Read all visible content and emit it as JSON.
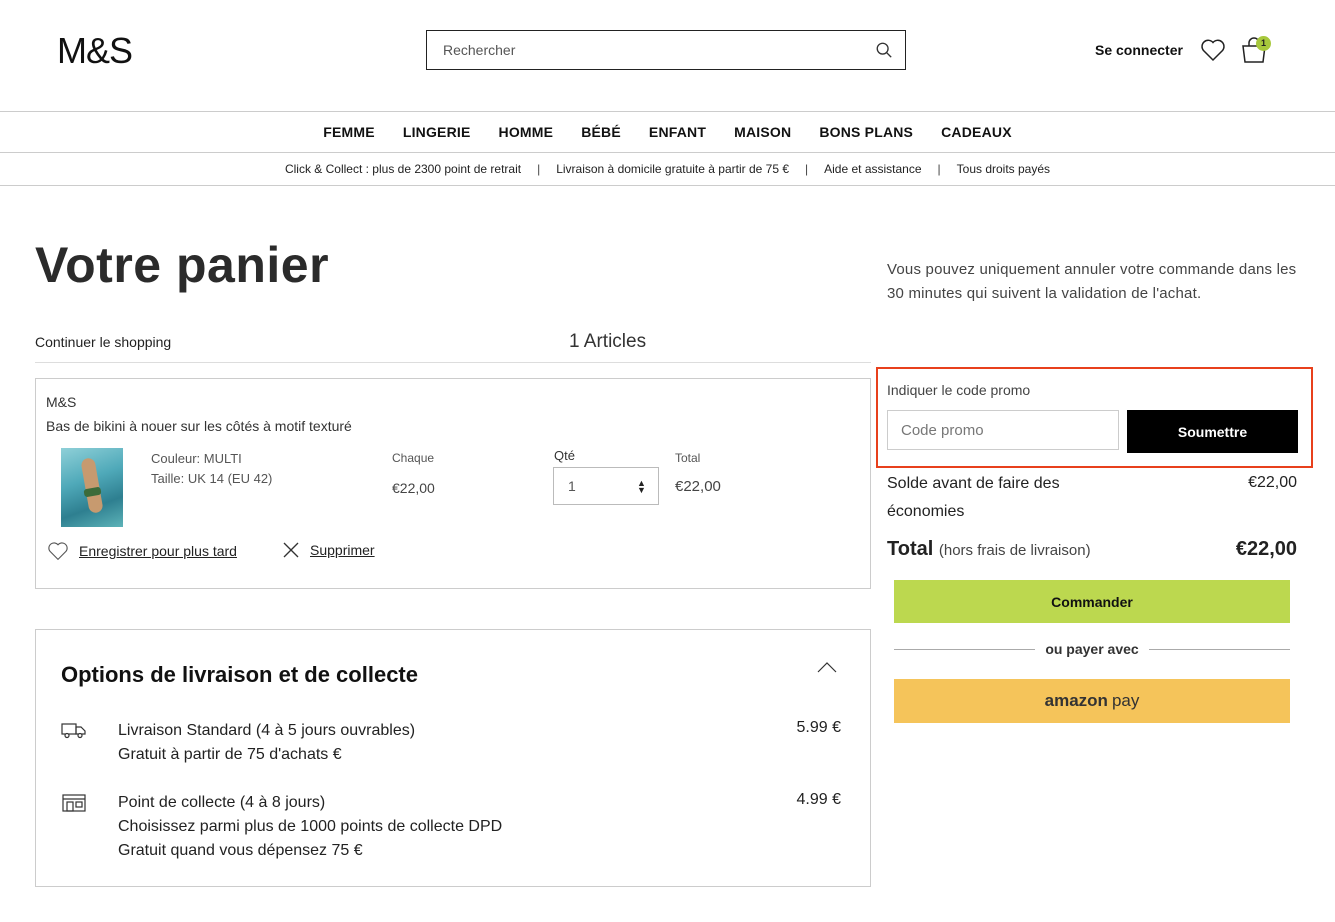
{
  "header": {
    "logo": "M&S",
    "search_placeholder": "Rechercher",
    "signin": "Se connecter",
    "bag_count": "1"
  },
  "nav": [
    "FEMME",
    "LINGERIE",
    "HOMME",
    "BÉBÉ",
    "ENFANT",
    "MAISON",
    "BONS PLANS",
    "CADEAUX"
  ],
  "infobar": [
    "Click & Collect : plus de 2300 point de retrait",
    "Livraison à domicile gratuite à partir de 75 €",
    "Aide et assistance",
    "Tous droits payés"
  ],
  "cart": {
    "title": "Votre panier",
    "continue": "Continuer le shopping",
    "articles": "1  Articles",
    "item": {
      "brand": "M&S",
      "name": "Bas de bikini à nouer sur les côtés à motif texturé",
      "color": "Couleur: MULTI",
      "size": "Taille: UK 14 (EU 42)",
      "each_label": "Chaque",
      "each_value": "€22,00",
      "qty_label": "Qté",
      "qty_value": "1",
      "total_label": "Total",
      "total_value": "€22,00",
      "save_later": "Enregistrer pour plus tard",
      "remove": "Supprimer"
    }
  },
  "delivery": {
    "title": "Options de livraison et de collecte",
    "options": [
      {
        "line1": "Livraison Standard (4 à 5 jours ouvrables)",
        "line2": "Gratuit à partir de 75 d'achats €",
        "line3": "",
        "price": "5.99 €",
        "icon": "truck-icon"
      },
      {
        "line1": "Point de collecte (4 à 8 jours)",
        "line2": "Choisissez parmi plus de 1000 points de collecte DPD",
        "line3": "Gratuit quand vous dépensez 75 €",
        "price": "4.99 €",
        "icon": "store-icon"
      }
    ]
  },
  "summary": {
    "cancel_note": "Vous pouvez uniquement annuler votre commande dans les 30 minutes qui suivent la validation de l'achat.",
    "promo_label": "Indiquer le code promo",
    "promo_placeholder": "Code promo",
    "promo_button": "Soumettre",
    "solde_label": "Solde avant de faire des économies",
    "solde_value": "€22,00",
    "total_label": "Total",
    "total_sub": "(hors frais de livraison)",
    "total_value": "€22,00",
    "checkout": "Commander",
    "or_pay": "ou payer avec",
    "amazon_1": "amazon",
    "amazon_2": "pay"
  },
  "colors": {
    "accent_green": "#bcd84f",
    "amazon_yellow": "#f5c45a",
    "highlight_red": "#e8401c"
  }
}
